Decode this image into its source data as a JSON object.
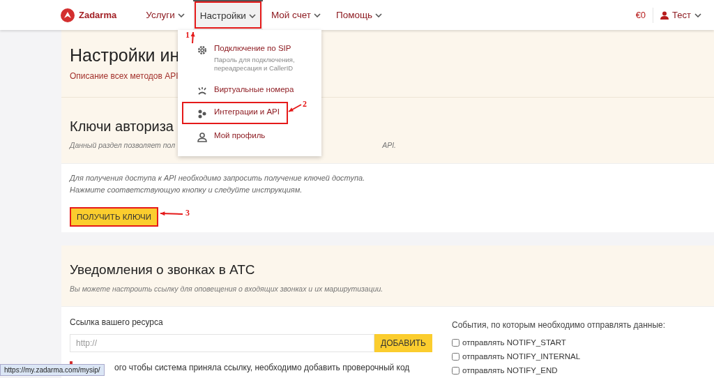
{
  "nav": {
    "logo": "Zadarma",
    "items": [
      {
        "label": "Услуги",
        "selected": false,
        "highlighted": false
      },
      {
        "label": "Настройки",
        "selected": true,
        "highlighted": true
      },
      {
        "label": "Мой счет",
        "selected": false,
        "highlighted": false
      },
      {
        "label": "Помощь",
        "selected": false,
        "highlighted": false
      }
    ],
    "balance": "€0",
    "user": "Тест"
  },
  "dropdown": {
    "items": [
      {
        "kind": "gear",
        "title": "Подключение по SIP",
        "description": "Пароль для подключения, переадресация и CallerID",
        "highlighted": false
      },
      {
        "kind": "phone",
        "title": "Виртуальные номера",
        "highlighted": false
      },
      {
        "kind": "nodes",
        "title": "Интеграции и API",
        "highlighted": true
      },
      {
        "kind": "person",
        "title": "Мой профиль",
        "highlighted": false
      }
    ]
  },
  "api_section": {
    "title": "Настройки ин",
    "link": "Описание всех методов API"
  },
  "keys_section": {
    "title": "Ключи авториза",
    "description_start": "Данный раздел позволяет пол",
    "description_end": "API.",
    "note": [
      "Для получения доступа к API необходимо запросить получение ключей доступа.",
      "Нажмите соответствующую кнопку и следуйте инструкциям."
    ],
    "button": {
      "label": "ПОЛУЧИТЬ КЛЮЧИ",
      "highlighted": true
    }
  },
  "notifications_section": {
    "title": "Уведомления о звонках в АТС",
    "description": "Вы можете настроить ссылку для оповещения о входящих звонках и их маршрутизации.",
    "url_label": "Ссылка вашего ресурса",
    "url_field": {
      "placeholder": "http://"
    },
    "add_button": "ДОБАВИТЬ",
    "warning": "ого чтобы система приняла ссылку, необходимо добавить проверочный код",
    "events_label": "События, по которым необходимо отправлять данные:",
    "events": [
      {
        "label": "отправлять NOTIFY_START",
        "checked": false
      },
      {
        "label": "отправлять NOTIFY_INTERNAL",
        "checked": false
      },
      {
        "label": "отправлять NOTIFY_END",
        "checked": false
      }
    ]
  },
  "annotations": [
    {
      "label": "1"
    },
    {
      "label": "2"
    },
    {
      "label": "3"
    }
  ],
  "status_url": "https://my.zadarma.com/mysip/"
}
